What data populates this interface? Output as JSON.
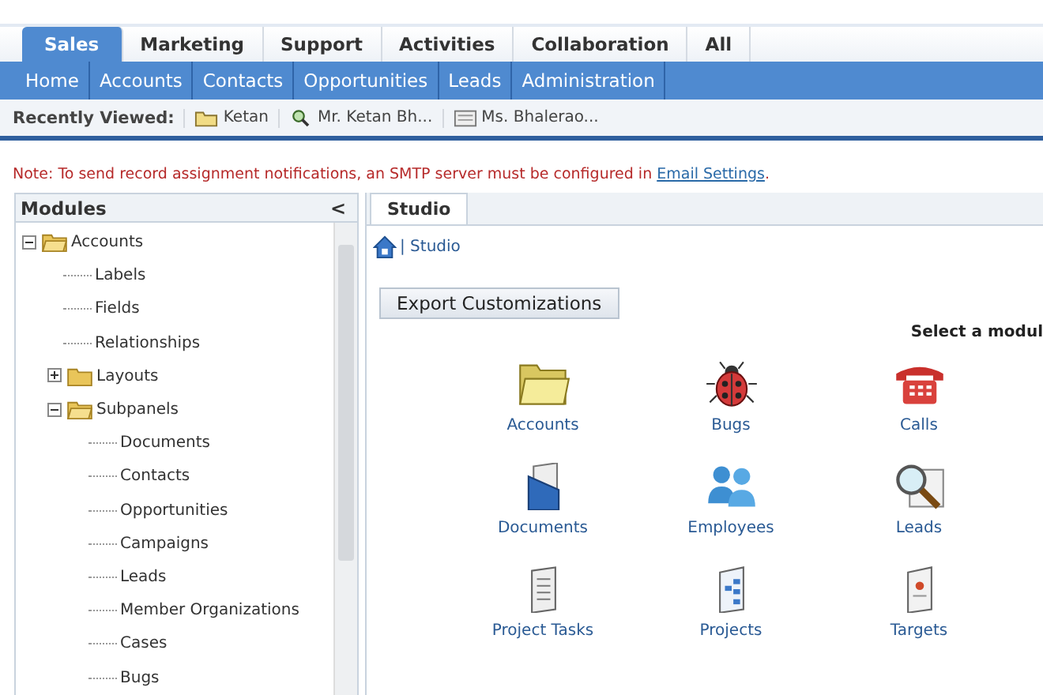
{
  "tabs": [
    {
      "label": "Sales",
      "selected": true
    },
    {
      "label": "Marketing",
      "selected": false
    },
    {
      "label": "Support",
      "selected": false
    },
    {
      "label": "Activities",
      "selected": false
    },
    {
      "label": "Collaboration",
      "selected": false
    },
    {
      "label": "All",
      "selected": false
    }
  ],
  "subnav": [
    "Home",
    "Accounts",
    "Contacts",
    "Opportunities",
    "Leads",
    "Administration"
  ],
  "recently_viewed": {
    "label": "Recently Viewed:",
    "items": [
      "Ketan",
      "Mr. Ketan Bh...",
      "Ms. Bhalerao..."
    ]
  },
  "notice": {
    "text": "Note: To send record assignment notifications, an SMTP server must be configured in",
    "link": "Email Settings",
    "end": "."
  },
  "modules_panel": {
    "title": "Modules",
    "collapse": "<",
    "tree": [
      {
        "label": "Accounts",
        "kind": "folder",
        "expanded": true,
        "children": [
          {
            "label": "Labels",
            "kind": "leaf"
          },
          {
            "label": "Fields",
            "kind": "leaf"
          },
          {
            "label": "Relationships",
            "kind": "leaf"
          },
          {
            "label": "Layouts",
            "kind": "folder",
            "expanded": false
          },
          {
            "label": "Subpanels",
            "kind": "folder",
            "expanded": true,
            "children": [
              {
                "label": "Documents",
                "kind": "leaf"
              },
              {
                "label": "Contacts",
                "kind": "leaf"
              },
              {
                "label": "Opportunities",
                "kind": "leaf"
              },
              {
                "label": "Campaigns",
                "kind": "leaf"
              },
              {
                "label": "Leads",
                "kind": "leaf"
              },
              {
                "label": "Member Organizations",
                "kind": "leaf"
              },
              {
                "label": "Cases",
                "kind": "leaf"
              },
              {
                "label": "Bugs",
                "kind": "leaf"
              }
            ]
          }
        ]
      }
    ]
  },
  "studio": {
    "tab": "Studio",
    "breadcrumb": "| Studio",
    "export_button": "Export Customizations",
    "prompt": "Select a modul",
    "modules": [
      "Accounts",
      "Bugs",
      "Calls",
      "Documents",
      "Employees",
      "Leads",
      "Project Tasks",
      "Projects",
      "Targets"
    ]
  }
}
